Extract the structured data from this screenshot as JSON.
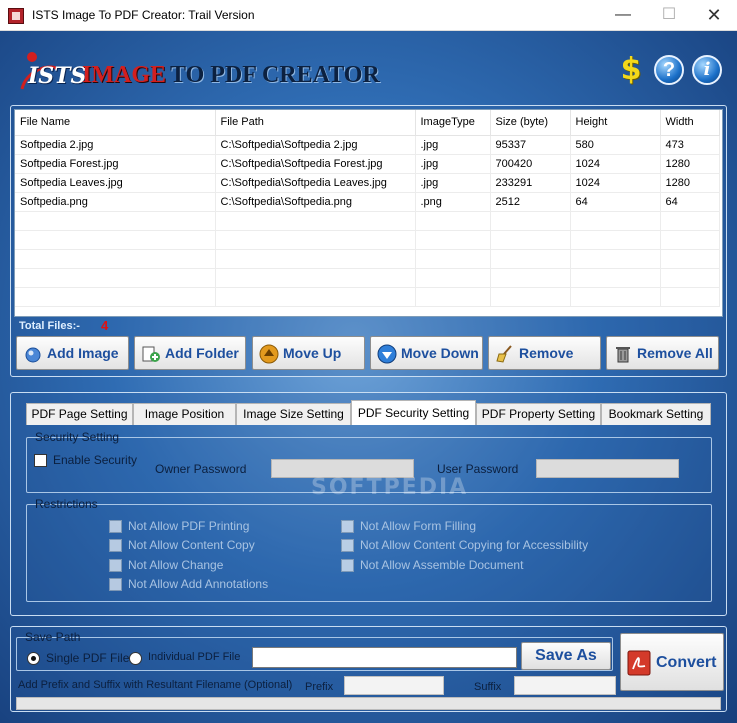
{
  "window": {
    "title": "ISTS Image To PDF Creator: Trail Version"
  },
  "header": {
    "logo_ists": "ISTS",
    "logo_word1": "IMAGE",
    "logo_word2": "TO PDF CREATOR",
    "icons": [
      "dollar-icon",
      "help-icon",
      "info-icon"
    ]
  },
  "files": {
    "columns": [
      "File Name",
      "File Path",
      "ImageType",
      "Size (byte)",
      "Height",
      "Width"
    ],
    "rows": [
      [
        "Softpedia 2.jpg",
        "C:\\Softpedia\\Softpedia 2.jpg",
        ".jpg",
        "95337",
        "580",
        "473"
      ],
      [
        "Softpedia Forest.jpg",
        "C:\\Softpedia\\Softpedia Forest.jpg",
        ".jpg",
        "700420",
        "1024",
        "1280"
      ],
      [
        "Softpedia Leaves.jpg",
        "C:\\Softpedia\\Softpedia Leaves.jpg",
        ".jpg",
        "233291",
        "1024",
        "1280"
      ],
      [
        "Softpedia.png",
        "C:\\Softpedia\\Softpedia.png",
        ".png",
        "2512",
        "64",
        "64"
      ]
    ],
    "total_label": "Total Files:-",
    "total_count": "4"
  },
  "actions": {
    "add_image": "Add Image",
    "add_folder": "Add Folder",
    "move_up": "Move Up",
    "move_down": "Move Down",
    "remove": "Remove",
    "remove_all": "Remove All"
  },
  "tabs": [
    "PDF Page Setting",
    "Image Position",
    "Image Size Setting",
    "PDF Security Setting",
    "PDF Property Setting",
    "Bookmark Setting"
  ],
  "active_tab": "PDF Security Setting",
  "security": {
    "group_title": "Security Setting",
    "enable_label": "Enable Security",
    "owner_label": "Owner Password",
    "user_label": "User Password",
    "owner_value": "",
    "user_value": ""
  },
  "restrictions": {
    "group_title": "Restrictions",
    "items": [
      "Not Allow PDF Printing",
      "Not Allow Content Copy",
      "Not Allow Change",
      "Not Allow Add Annotations",
      "Not Allow Form Filling",
      "Not Allow Content Copying for Accessibility",
      "Not Allow Assemble Document"
    ]
  },
  "watermark": "SOFTPEDIA",
  "save": {
    "group_title": "Save Path",
    "single_label": "Single PDF File",
    "individual_label": "Individual PDF File",
    "path_value": "",
    "save_as": "Save As",
    "prefix_suffix_label": "Add Prefix and Suffix with Resultant Filename (Optional)",
    "prefix_label": "Prefix",
    "suffix_label": "Suffix",
    "prefix_value": "",
    "suffix_value": ""
  },
  "convert": "Convert",
  "colors": {
    "accent": "#1d4f9e",
    "logo_red": "#d21f1f",
    "count_red": "#e01010"
  }
}
